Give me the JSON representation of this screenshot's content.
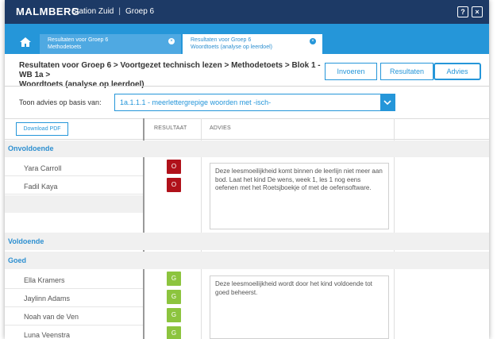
{
  "topbar": {
    "logo": "MALMBERG",
    "school": "Station Zuid",
    "separator": "|",
    "group": "Groep 6",
    "help_label": "?",
    "close_label": "×",
    "bg_color": "#1d3a66"
  },
  "tabs": [
    {
      "line1": "Resultaten voor Groep 6",
      "line2": "Methodetoets",
      "active": false
    },
    {
      "line1": "Resultaten voor Groep 6",
      "line2": "Woordtoets (analyse op leerdoel)",
      "active": true
    }
  ],
  "tab_close_glyph": "×",
  "breadcrumb": {
    "line1": "Resultaten voor Groep 6 > Voortgezet technisch lezen > Methodetoets > Blok 1 - WB 1a >",
    "line2": "Woordtoets (analyse op leerdoel)"
  },
  "actions": {
    "invoeren": "Invoeren",
    "resultaten": "Resultaten",
    "advies": "Advies"
  },
  "filter": {
    "label": "Toon advies op basis van:",
    "selected": "1a.1.1.1 - meerlettergrepige woorden met -isch-"
  },
  "table": {
    "download": "Download PDF",
    "col_result": "RESULTAAT",
    "col_advice": "ADVIES"
  },
  "groups": {
    "onvoldoende": {
      "label": "Onvoldoende",
      "students": [
        {
          "name": "Yara Carroll",
          "result": "O"
        },
        {
          "name": "Fadil Kaya",
          "result": "O"
        }
      ],
      "advice": "Deze leesmoeilijkheid komt binnen de leerlijn niet meer aan bod. Laat het kind De wens, week 1, les 1 nog eens oefenen met het Roetsjboekje of met de oefensoftware."
    },
    "voldoende": {
      "label": "Voldoende"
    },
    "goed": {
      "label": "Goed",
      "students": [
        {
          "name": "Ella Kramers",
          "result": "G"
        },
        {
          "name": "Jaylinn Adams",
          "result": "G"
        },
        {
          "name": "Noah van de Ven",
          "result": "G"
        },
        {
          "name": "Luna Veenstra",
          "result": "G"
        }
      ],
      "advice": "Deze leesmoeilijkheid wordt door het kind voldoende tot goed beheerst."
    }
  },
  "colors": {
    "accent": "#2596d9",
    "insufficient": "#b0111a",
    "good": "#8cc43e"
  },
  "icons": {
    "home": "home-icon",
    "dropdown": "chevron-down-icon"
  }
}
